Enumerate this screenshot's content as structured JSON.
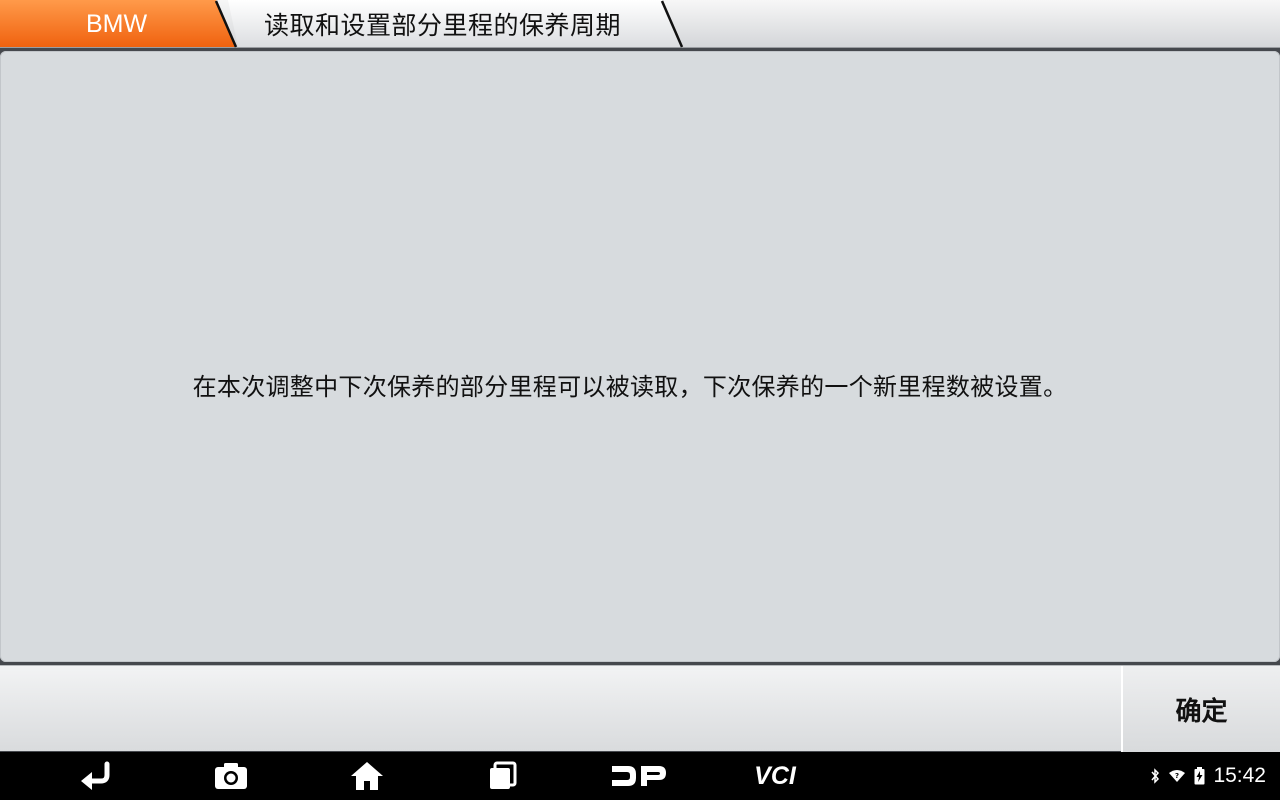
{
  "header": {
    "brand_label": "BMW",
    "title": "读取和设置部分里程的保养周期",
    "brand_color": "#f36f21"
  },
  "main": {
    "message": "在本次调整中下次保养的部分里程可以被读取，下次保养的一个新里程数被设置。"
  },
  "footer": {
    "confirm_label": "确定"
  },
  "nav": {
    "items": [
      {
        "name": "back-icon"
      },
      {
        "name": "camera-icon"
      },
      {
        "name": "home-icon"
      },
      {
        "name": "recent-apps-icon"
      },
      {
        "name": "dp-icon"
      },
      {
        "name": "vci-icon",
        "label": "VCI"
      }
    ],
    "status": {
      "icons": [
        "bluetooth-icon",
        "wifi-icon",
        "battery-charging-icon"
      ],
      "time": "15:42"
    }
  }
}
